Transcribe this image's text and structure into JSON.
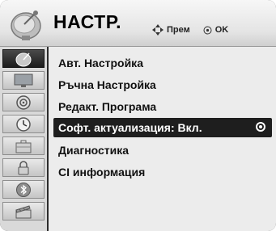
{
  "header": {
    "title": "НАСТР.",
    "move_label": "Прем",
    "ok_label": "OK"
  },
  "sidebar": {
    "items": [
      {
        "icon": "satellite-icon",
        "active": true
      },
      {
        "icon": "tv-screen-icon",
        "active": false
      },
      {
        "icon": "speaker-icon",
        "active": false
      },
      {
        "icon": "clock-icon",
        "active": false
      },
      {
        "icon": "briefcase-icon",
        "active": false
      },
      {
        "icon": "lock-icon",
        "active": false
      },
      {
        "icon": "bluetooth-icon",
        "active": false
      },
      {
        "icon": "film-clapper-icon",
        "active": false
      }
    ]
  },
  "menu": {
    "items": [
      {
        "label": "Авт. Настройка"
      },
      {
        "label": "Ръчна Настройка"
      },
      {
        "label": "Редакт. Програма"
      },
      {
        "label": "Софт. актуализация: Вкл."
      },
      {
        "label": "Диагностика"
      },
      {
        "label": "CI информация"
      }
    ],
    "selected_index": 3
  }
}
